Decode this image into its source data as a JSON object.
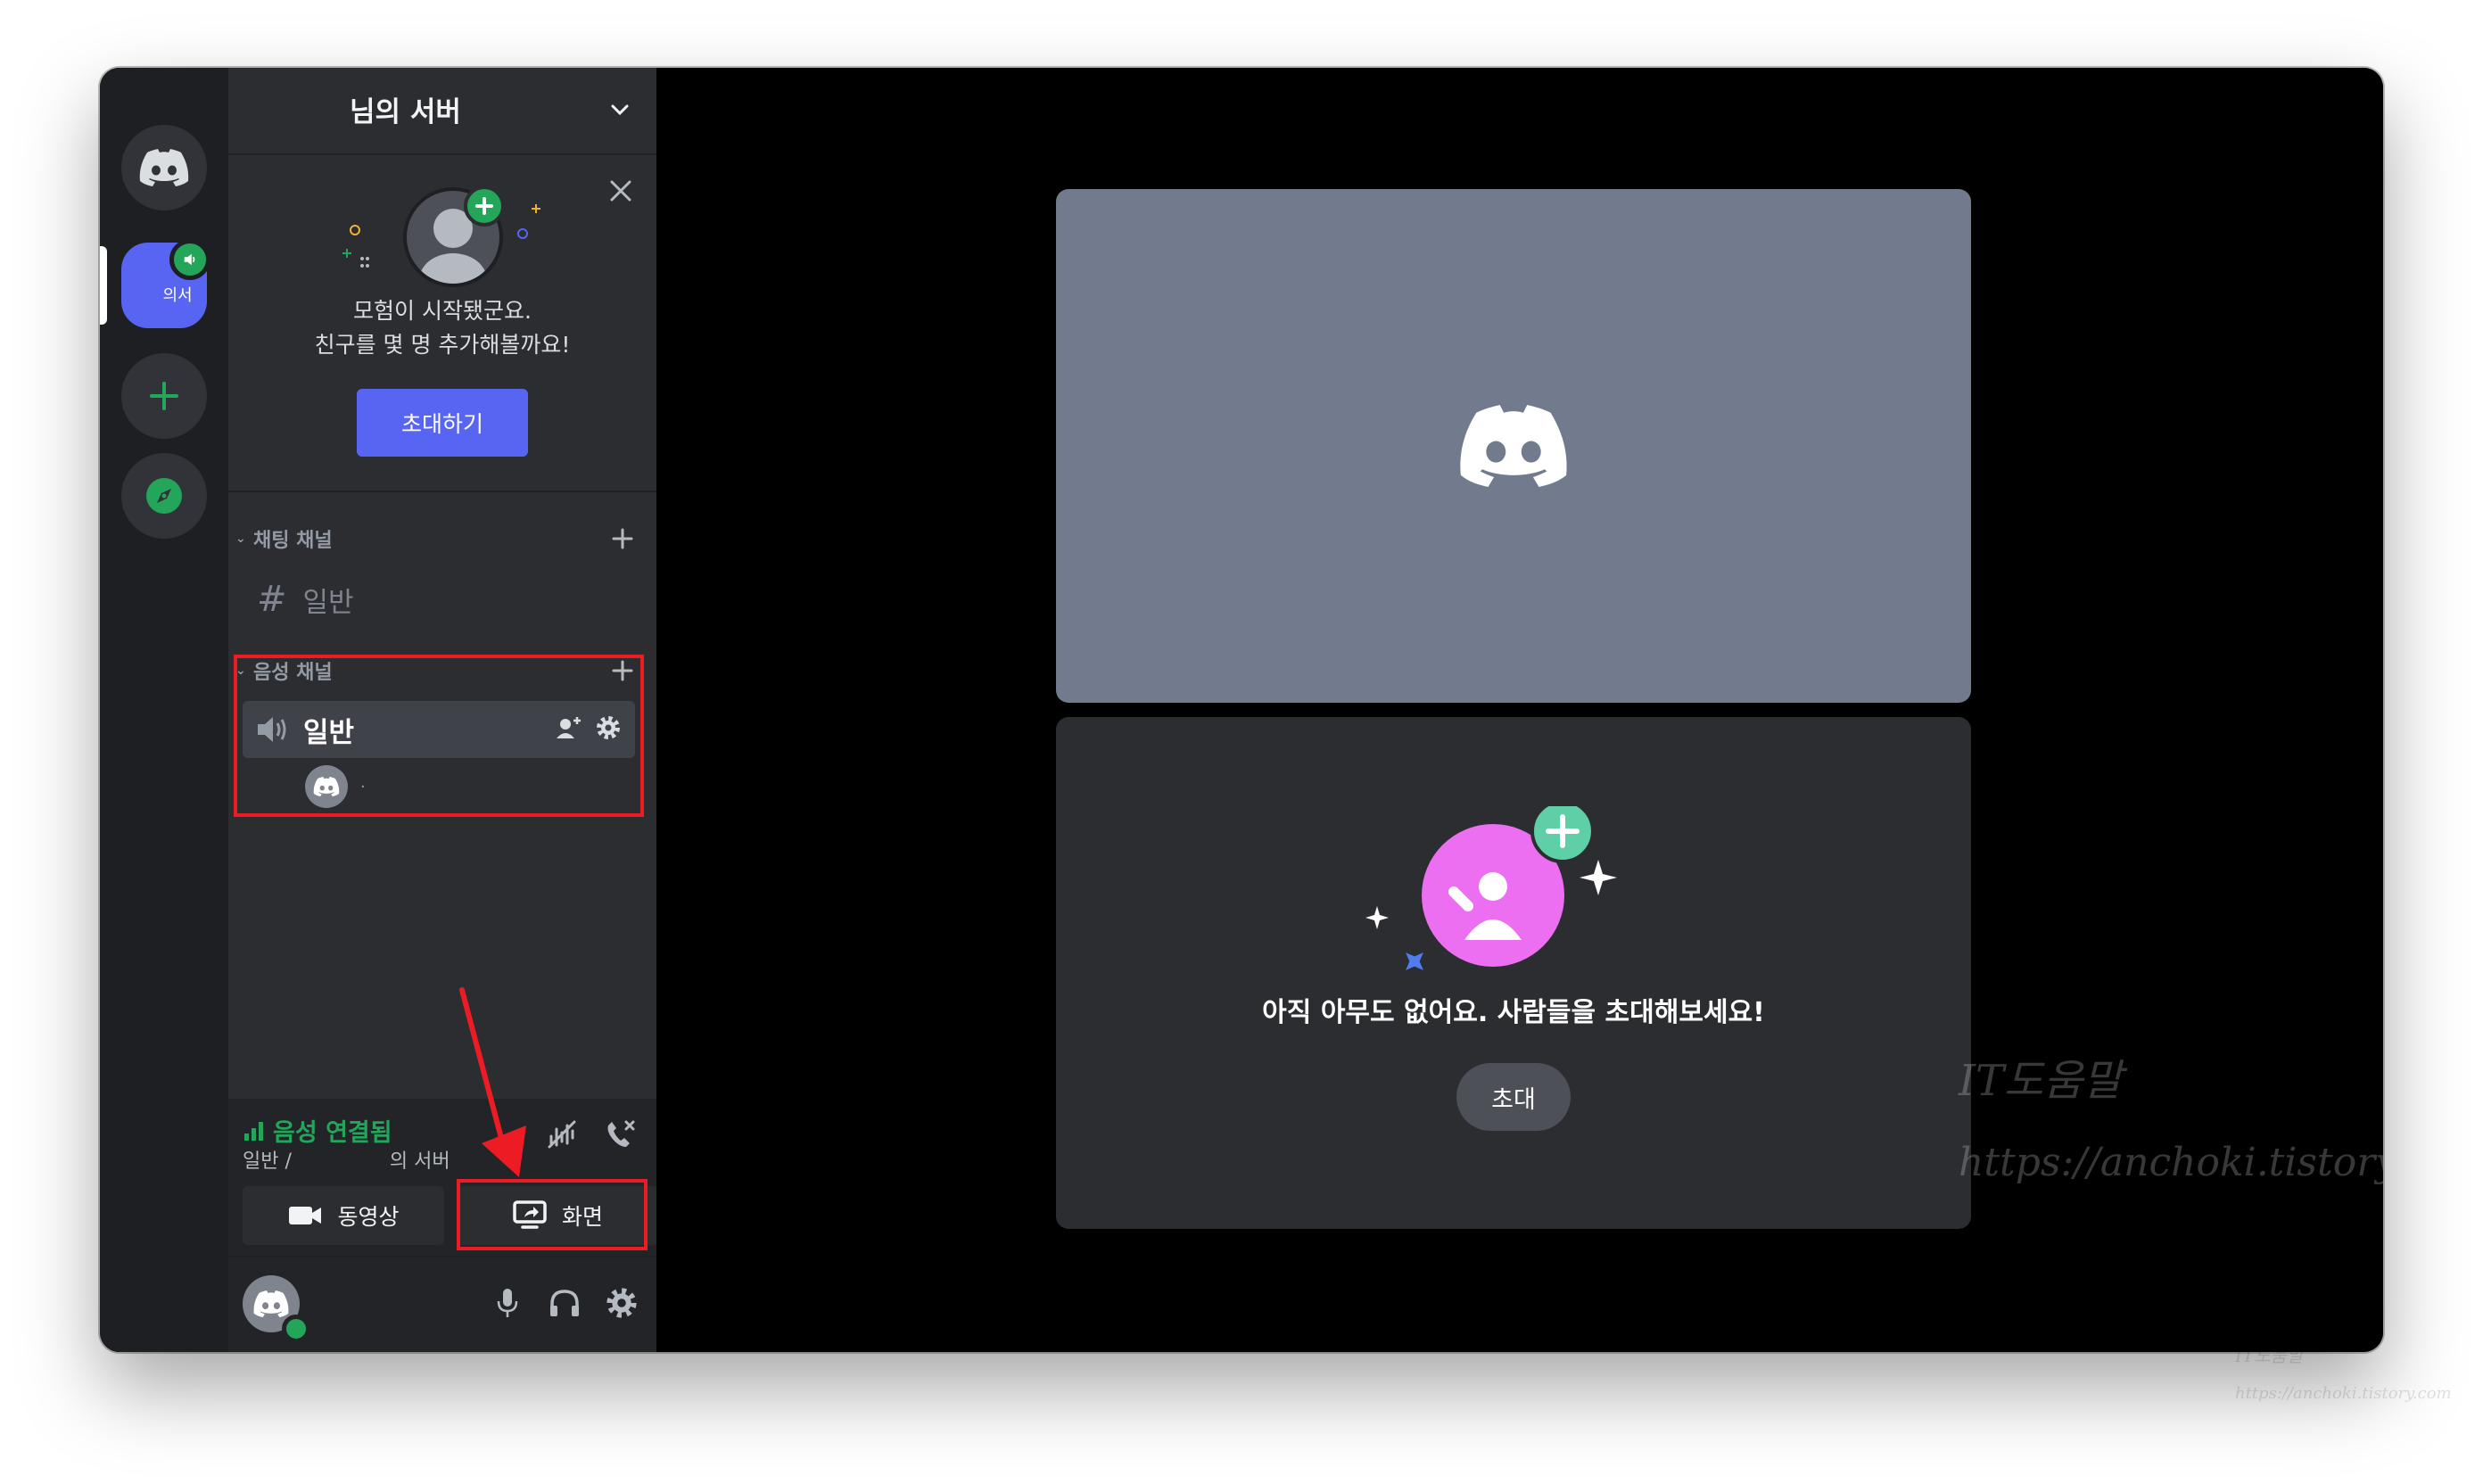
{
  "server": {
    "name": "님의 서버",
    "abbr": "의서"
  },
  "welcome": {
    "line1": "모험이 시작됐군요.",
    "line2": "친구를 몇 명 추가해볼까요!",
    "invite_label": "초대하기"
  },
  "categories": {
    "text": "채팅 채널",
    "voice": "음성 채널"
  },
  "channels": {
    "text_general": "일반",
    "voice_general": "일반",
    "voice_user": "·"
  },
  "voice_panel": {
    "status": "음성 연결됨",
    "location_channel": "일반 /",
    "location_server": "의 서버",
    "video_label": "동영상",
    "screen_label": "화면"
  },
  "stage": {
    "empty_text": "아직 아무도 없어요. 사람들을 초대해보세요!",
    "invite_label": "초대"
  },
  "watermark": {
    "line1": "IT도움말",
    "line2": "https://anchoki.tistory.com"
  },
  "colors": {
    "blurple": "#5865f2",
    "green": "#23a55a",
    "highlight": "#ed1b24",
    "tile_gray": "#717b8d",
    "pink": "#eb6ff0",
    "teal": "#5ecfa6"
  },
  "icons": {
    "home": "discord-logo-icon",
    "add_server": "plus-icon",
    "explore": "compass-icon",
    "server_chevron": "chevron-down-icon",
    "close": "close-icon",
    "text_channel": "hash-icon",
    "voice_channel": "speaker-icon",
    "invite_member": "add-member-icon",
    "settings": "gear-icon",
    "signal": "signal-bars-icon",
    "noise": "noise-suppression-icon",
    "disconnect": "phone-disconnect-icon",
    "video": "video-camera-icon",
    "screen": "screen-share-icon",
    "mic": "microphone-icon",
    "headphones": "headphones-icon"
  }
}
